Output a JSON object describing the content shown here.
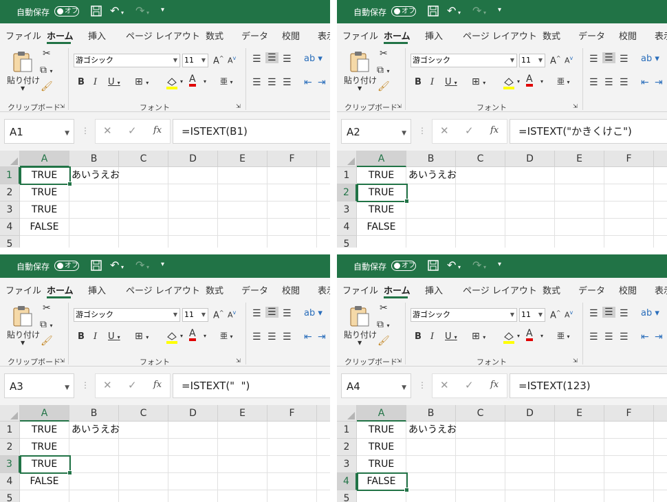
{
  "app": {
    "autosave_label": "自動保存",
    "autosave_state": "オフ",
    "accent_color": "#217346"
  },
  "tabs": [
    "ファイル",
    "ホーム",
    "挿入",
    "ページ レイアウト",
    "数式",
    "データ",
    "校閲",
    "表示"
  ],
  "ribbon": {
    "paste_label": "貼り付け",
    "clipboard_label": "クリップボード",
    "font_group_label": "フォント",
    "font_name": "游ゴシック",
    "font_size": "11",
    "bold": "B",
    "italic": "I",
    "underline": "U",
    "grow": "A",
    "shrink": "A"
  },
  "columns": [
    "A",
    "B",
    "C",
    "D",
    "E",
    "F"
  ],
  "rows": [
    "1",
    "2",
    "3",
    "4",
    "5"
  ],
  "cells": {
    "A": [
      "TRUE",
      "TRUE",
      "TRUE",
      "FALSE"
    ],
    "B1": "あいうえお"
  },
  "panels": [
    {
      "name_box": "A1",
      "formula": "=ISTEXT(B1)",
      "active_row": 1
    },
    {
      "name_box": "A2",
      "formula": "=ISTEXT(\"かきくけこ\")",
      "active_row": 2
    },
    {
      "name_box": "A3",
      "formula": "=ISTEXT(\"  \")",
      "active_row": 3
    },
    {
      "name_box": "A4",
      "formula": "=ISTEXT(123)",
      "active_row": 4
    }
  ]
}
